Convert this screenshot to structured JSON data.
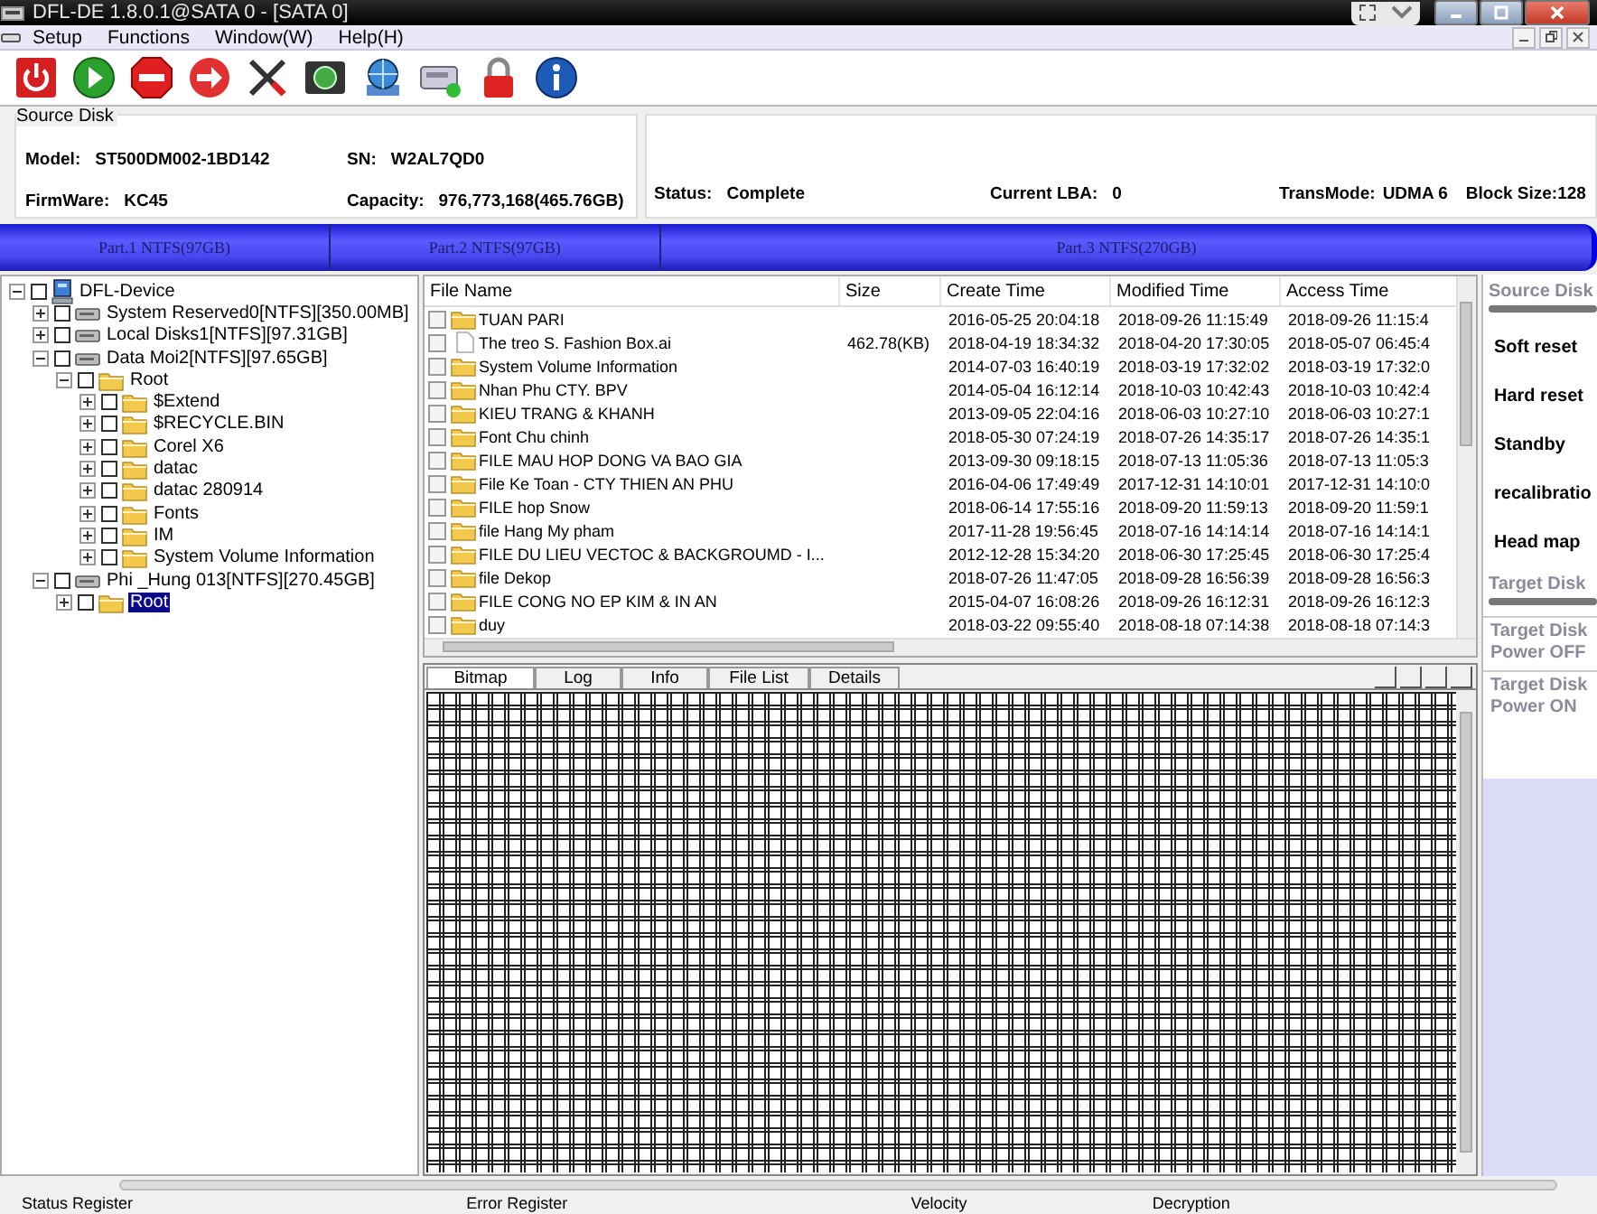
{
  "window": {
    "title": "DFL-DE 1.8.0.1@SATA 0 - [SATA 0]"
  },
  "menu": [
    "Setup",
    "Functions",
    "Window(W)",
    "Help(H)"
  ],
  "source_disk": {
    "title": "Source Disk",
    "fields": [
      {
        "label": "Model:",
        "value": "ST500DM002-1BD142"
      },
      {
        "label": "SN:",
        "value": "W2AL7QD0"
      },
      {
        "label": "FirmWare:",
        "value": "KC45"
      },
      {
        "label": "Capacity:",
        "value": "976,773,168(465.76GB)"
      }
    ]
  },
  "disk_status": [
    {
      "label": "Status:",
      "value": "Complete"
    },
    {
      "label": "Current LBA:",
      "value": "0"
    },
    {
      "label": "TransMode:",
      "value": "UDMA 6"
    },
    {
      "label": "Block Size:",
      "value": "128"
    }
  ],
  "partitions": [
    {
      "label": "Part.1 NTFS(97GB)",
      "level": 0.207
    },
    {
      "label": "Part.2 NTFS(97GB)",
      "level": 0.207
    },
    {
      "label": "Part.3 NTFS(270GB)",
      "level": 0.586
    }
  ],
  "tree": [
    {
      "label": "DFL-Device",
      "kind": "device",
      "expanded": true,
      "checked": false,
      "selected": false,
      "children": [
        {
          "label": "System Reserved0[NTFS][350.00MB]",
          "kind": "disk",
          "expanded": false,
          "checked": false,
          "selected": false
        },
        {
          "label": "Local Disks1[NTFS][97.31GB]",
          "kind": "disk",
          "expanded": false,
          "checked": false,
          "selected": false
        },
        {
          "label": "Data Moi2[NTFS][97.65GB]",
          "kind": "disk",
          "expanded": true,
          "checked": false,
          "selected": false,
          "children": [
            {
              "label": "Root",
              "kind": "folder",
              "expanded": true,
              "checked": false,
              "selected": false,
              "children": [
                {
                  "label": "$Extend",
                  "kind": "folder",
                  "expanded": false,
                  "checked": false,
                  "selected": false
                },
                {
                  "label": "$RECYCLE.BIN",
                  "kind": "folder",
                  "expanded": false,
                  "checked": false,
                  "selected": false
                },
                {
                  "label": "Corel X6",
                  "kind": "folder",
                  "expanded": false,
                  "checked": false,
                  "selected": false
                },
                {
                  "label": "datac",
                  "kind": "folder",
                  "expanded": false,
                  "checked": false,
                  "selected": false
                },
                {
                  "label": "datac 280914",
                  "kind": "folder",
                  "expanded": false,
                  "checked": false,
                  "selected": false
                },
                {
                  "label": "Fonts",
                  "kind": "folder",
                  "expanded": false,
                  "checked": false,
                  "selected": false
                },
                {
                  "label": "IM",
                  "kind": "folder",
                  "expanded": false,
                  "checked": false,
                  "selected": false
                },
                {
                  "label": "System Volume Information",
                  "kind": "folder",
                  "expanded": false,
                  "checked": false,
                  "selected": false
                }
              ]
            }
          ]
        },
        {
          "label": "Phi _Hung 013[NTFS][270.45GB]",
          "kind": "disk",
          "expanded": true,
          "checked": false,
          "selected": false,
          "children": [
            {
              "label": "Root",
              "kind": "folder",
              "expanded": false,
              "checked": false,
              "selected": true
            }
          ]
        }
      ]
    }
  ],
  "file_list": {
    "columns": [
      "File Name",
      "Size",
      "Create Time",
      "Modified Time",
      "Access Time"
    ],
    "rows": [
      {
        "kind": "folder",
        "checked": false,
        "name": "TUAN PARI",
        "size": "",
        "created": "2016-05-25  20:04:18",
        "modified": "2018-09-26  11:15:49",
        "accessed": "2018-09-26  11:15:4"
      },
      {
        "kind": "file",
        "checked": false,
        "name": "The treo S. Fashion Box.ai",
        "size": "462.78(KB)",
        "created": "2018-04-19  18:34:32",
        "modified": "2018-04-20  17:30:05",
        "accessed": "2018-05-07  06:45:4"
      },
      {
        "kind": "folder",
        "checked": false,
        "name": "System Volume Information",
        "size": "",
        "created": "2014-07-03  16:40:19",
        "modified": "2018-03-19  17:32:02",
        "accessed": "2018-03-19  17:32:0"
      },
      {
        "kind": "folder",
        "checked": false,
        "name": "Nhan Phu CTY. BPV",
        "size": "",
        "created": "2014-05-04  16:12:14",
        "modified": "2018-10-03  10:42:43",
        "accessed": "2018-10-03  10:42:4"
      },
      {
        "kind": "folder",
        "checked": false,
        "name": "KIEU TRANG & KHANH",
        "size": "",
        "created": "2013-09-05  22:04:16",
        "modified": "2018-06-03  10:27:10",
        "accessed": "2018-06-03  10:27:1"
      },
      {
        "kind": "folder",
        "checked": false,
        "name": "Font Chu chinh",
        "size": "",
        "created": "2018-05-30  07:24:19",
        "modified": "2018-07-26  14:35:17",
        "accessed": "2018-07-26  14:35:1"
      },
      {
        "kind": "folder",
        "checked": false,
        "name": "FILE MAU HOP DONG VA BAO GIA",
        "size": "",
        "created": "2013-09-30  09:18:15",
        "modified": "2018-07-13  11:05:36",
        "accessed": "2018-07-13  11:05:3"
      },
      {
        "kind": "folder",
        "checked": false,
        "name": "File Ke Toan - CTY THIEN AN PHU",
        "size": "",
        "created": "2016-04-06  17:49:49",
        "modified": "2017-12-31  14:10:01",
        "accessed": "2017-12-31  14:10:0"
      },
      {
        "kind": "folder",
        "checked": false,
        "name": "FILE hop Snow",
        "size": "",
        "created": "2018-06-14  17:55:16",
        "modified": "2018-09-20  11:59:13",
        "accessed": "2018-09-20  11:59:1"
      },
      {
        "kind": "folder",
        "checked": false,
        "name": "file Hang My pham",
        "size": "",
        "created": "2017-11-28  19:56:45",
        "modified": "2018-07-16  14:14:14",
        "accessed": "2018-07-16  14:14:1"
      },
      {
        "kind": "folder",
        "checked": false,
        "name": "FILE DU LIEU VECTOC & BACKGROUMD - I...",
        "size": "",
        "created": "2012-12-28  15:34:20",
        "modified": "2018-06-30  17:25:45",
        "accessed": "2018-06-30  17:25:4"
      },
      {
        "kind": "folder",
        "checked": false,
        "name": "file Dekop",
        "size": "",
        "created": "2018-07-26  11:47:05",
        "modified": "2018-09-28  16:56:39",
        "accessed": "2018-09-28  16:56:3"
      },
      {
        "kind": "folder",
        "checked": false,
        "name": "FILE CONG NO EP KIM  & IN AN",
        "size": "",
        "created": "2015-04-07  16:08:26",
        "modified": "2018-09-26  16:12:31",
        "accessed": "2018-09-26  16:12:3"
      },
      {
        "kind": "folder",
        "checked": false,
        "name": "duy",
        "size": "",
        "created": "2018-03-22  09:55:40",
        "modified": "2018-08-18  07:14:38",
        "accessed": "2018-08-18  07:14:3"
      }
    ]
  },
  "view_tabs": [
    {
      "label": "Bitmap",
      "selected": true
    },
    {
      "label": "Log",
      "selected": false
    },
    {
      "label": "Info",
      "selected": false
    },
    {
      "label": "File List",
      "selected": false
    },
    {
      "label": "Details",
      "selected": false
    }
  ],
  "side_panel": [
    {
      "kind": "header",
      "label": "Source Disk"
    },
    {
      "kind": "button",
      "label": "Soft reset"
    },
    {
      "kind": "button",
      "label": "Hard reset"
    },
    {
      "kind": "button",
      "label": "Standby"
    },
    {
      "kind": "button",
      "label": "recalibratio"
    },
    {
      "kind": "button",
      "label": "Head map"
    },
    {
      "kind": "header",
      "label": "Target Disk"
    },
    {
      "kind": "power",
      "label": "Target Disk Power OFF"
    },
    {
      "kind": "power",
      "label": "Target Disk Power ON"
    }
  ],
  "status_bar": [
    "Status Register",
    "Error Register",
    "Velocity",
    "Decryption"
  ]
}
